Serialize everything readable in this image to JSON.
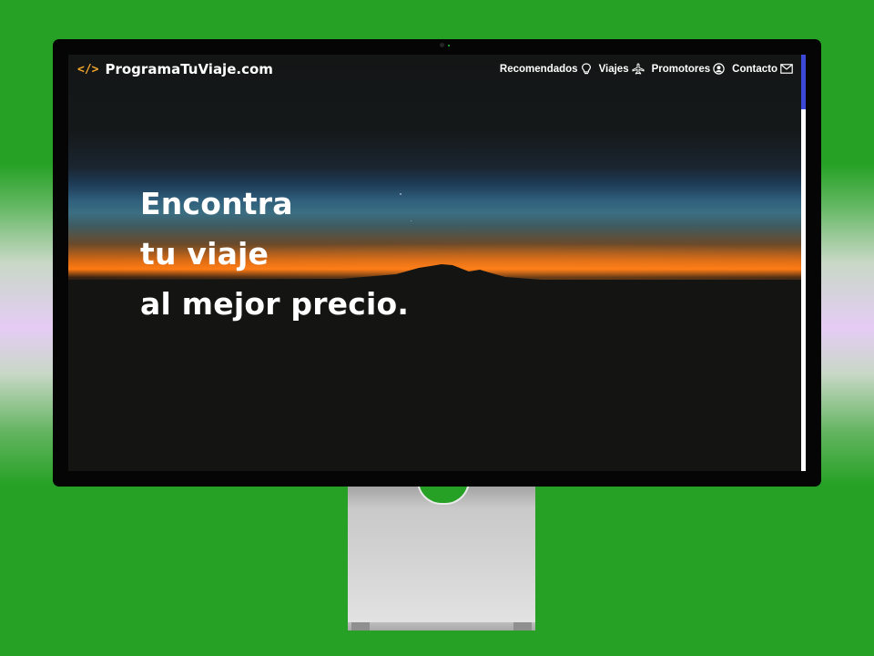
{
  "brand": {
    "icon": "code-icon",
    "icon_glyph": "</>",
    "name": "ProgramaTuViaje.com",
    "accent_color": "#f2a62c"
  },
  "nav": {
    "items": [
      {
        "label": "Recomendados",
        "icon": "lightbulb-icon"
      },
      {
        "label": "Viajes",
        "icon": "airplane-icon"
      },
      {
        "label": "Promotores",
        "icon": "user-circle-icon"
      },
      {
        "label": "Contacto",
        "icon": "envelope-icon"
      }
    ]
  },
  "hero": {
    "lines": [
      "Encontra",
      "tu viaje",
      "al mejor precio."
    ]
  },
  "colors": {
    "page_background": "#26a125",
    "scroll_thumb": "#3b48d8",
    "sunset": "#ff7a12"
  }
}
